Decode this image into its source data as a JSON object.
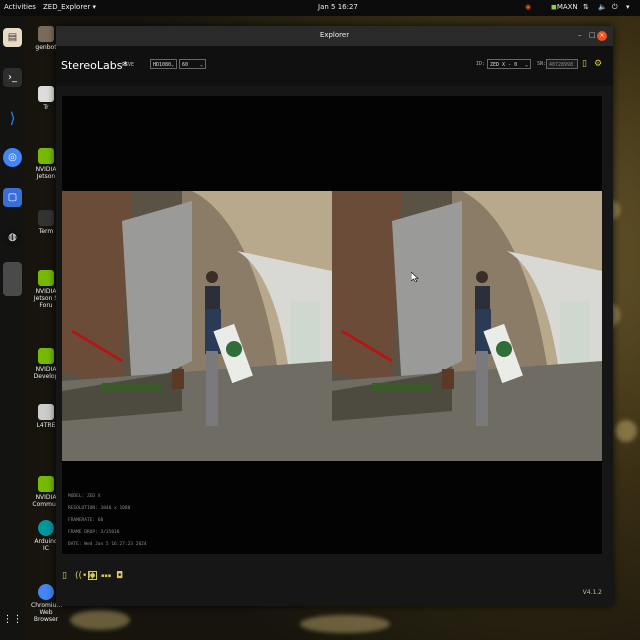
{
  "topbar": {
    "activities": "Activities",
    "app_menu": "ZED_Explorer",
    "clock": "Jan 5  16:27",
    "tray_label": "MAXN"
  },
  "desktop_icons": [
    {
      "label": "genbot"
    },
    {
      "label": "Tr"
    },
    {
      "label": "NVIDIA Jetson"
    },
    {
      "label": "Term"
    },
    {
      "label": "NVIDIA Jetson S Foru"
    },
    {
      "label": "NVIDIA Develop"
    },
    {
      "label": "L4TRE"
    },
    {
      "label": "NVIDIA Commun"
    },
    {
      "label": "Arduino IC"
    },
    {
      "label": "Chromium Web Browser"
    }
  ],
  "window": {
    "title": "Explorer",
    "minimize": "–",
    "maximize": "□",
    "close": "×"
  },
  "header": {
    "logo": "StereoLabs*",
    "live": "LIVE",
    "resolution": "HD1080",
    "fps": "60",
    "id_label": "ID:",
    "id_value": "ZED X - 0",
    "sn_label": "SN:",
    "sn_value": "40728998"
  },
  "info": {
    "model": "MODEL: ZED X",
    "resolution": "RESOLUTION: 3840 x 1080",
    "framerate": "FRAMERATE: 60",
    "frame_drop": "FRAME DROP: 3/35010",
    "date": "DATE: Wed Jan 5 16:27:23 2024"
  },
  "footer": {
    "version": "V4.1.2"
  },
  "colors": {
    "accent": "#d6c957",
    "close": "#e95420",
    "window_bg": "#161616",
    "viewer_bg": "#030303"
  }
}
